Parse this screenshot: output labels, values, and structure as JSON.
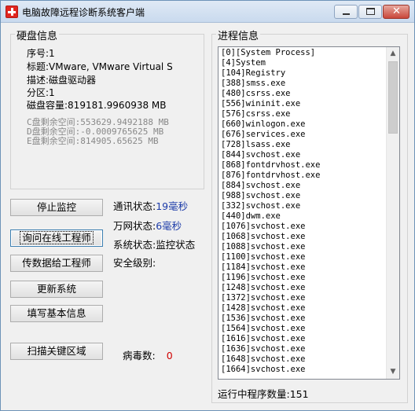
{
  "window": {
    "title": "电脑故障远程诊断系统客户端"
  },
  "disk_group": {
    "legend": "硬盘信息",
    "seq": "序号:1",
    "label": "标题:VMware, VMware Virtual S",
    "desc": "描述:磁盘驱动器",
    "partition": "分区:1",
    "capacity": "磁盘容量:819181.9960938 MB",
    "free_c": "C盘剩余空间:553629.9492188 MB",
    "free_d": "D盘剩余空间:-0.0009765625 MB",
    "free_e": "E盘剩余空间:814905.65625 MB"
  },
  "buttons": {
    "stop_monitor": "停止监控",
    "ask_engineer": "询问在线工程师",
    "send_data": "传数据给工程师",
    "update_system": "更新系统",
    "fill_info": "填写基本信息",
    "scan_key": "扫描关键区域"
  },
  "status": {
    "comm_label": "通讯状态:",
    "comm_value": "19毫秒",
    "net_label": "万网状态:",
    "net_value": "6毫秒",
    "system_label": "系统状态:",
    "system_value": "监控状态",
    "security_label": "安全级别:",
    "virus_label": "病毒数:",
    "virus_value": "0"
  },
  "process_group": {
    "legend": "进程信息",
    "items": [
      "[0][System Process]",
      "[4]System",
      "[104]Registry",
      "[388]smss.exe",
      "[480]csrss.exe",
      "[556]wininit.exe",
      "[576]csrss.exe",
      "[660]winlogon.exe",
      "[676]services.exe",
      "[728]lsass.exe",
      "[844]svchost.exe",
      "[868]fontdrvhost.exe",
      "[876]fontdrvhost.exe",
      "[884]svchost.exe",
      "[988]svchost.exe",
      "[332]svchost.exe",
      "[440]dwm.exe",
      "[1076]svchost.exe",
      "[1068]svchost.exe",
      "[1088]svchost.exe",
      "[1100]svchost.exe",
      "[1184]svchost.exe",
      "[1196]svchost.exe",
      "[1248]svchost.exe",
      "[1372]svchost.exe",
      "[1428]svchost.exe",
      "[1536]svchost.exe",
      "[1564]svchost.exe",
      "[1616]svchost.exe",
      "[1636]svchost.exe",
      "[1648]svchost.exe",
      "[1664]svchost.exe"
    ],
    "running_label": "运行中程序数量:",
    "running_count": "151"
  },
  "colors": {
    "status_value": "#1c3ba8",
    "virus_value": "#d00000",
    "title_gradient": "#c9daee"
  }
}
